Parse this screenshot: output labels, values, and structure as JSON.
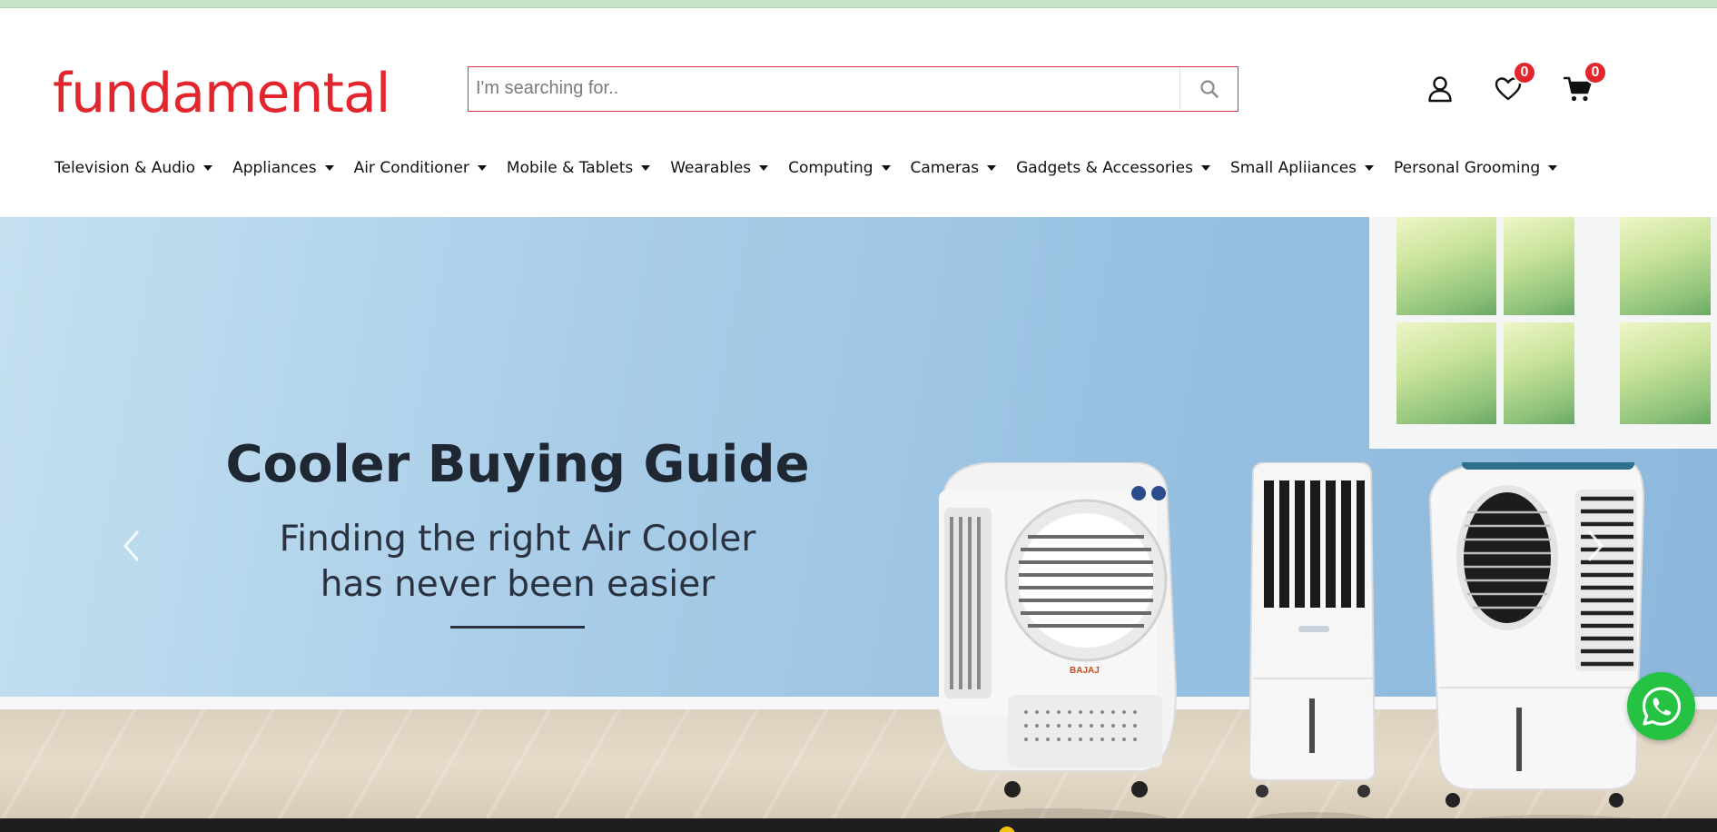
{
  "brand": {
    "logo_text": "fundamental",
    "accent_color": "#e3262d"
  },
  "search": {
    "placeholder": "I'm searching for..",
    "icon": "search-icon"
  },
  "header_actions": {
    "account_icon": "user-icon",
    "wishlist": {
      "icon": "heart-icon",
      "count": "0"
    },
    "cart": {
      "icon": "cart-icon",
      "count": "0"
    }
  },
  "nav": {
    "items": [
      {
        "label": "Television & Audio"
      },
      {
        "label": "Appliances"
      },
      {
        "label": "Air Conditioner"
      },
      {
        "label": "Mobile & Tablets"
      },
      {
        "label": "Wearables"
      },
      {
        "label": "Computing"
      },
      {
        "label": "Cameras"
      },
      {
        "label": "Gadgets & Accessories"
      },
      {
        "label": "Small Apliiances"
      },
      {
        "label": "Personal Grooming"
      }
    ]
  },
  "banner": {
    "title": "Cooler Buying Guide",
    "subtitle_line1": "Finding the right Air Cooler",
    "subtitle_line2": "has never been easier",
    "product_brand": "BAJAJ",
    "prev_icon": "chevron-left-icon",
    "next_icon": "chevron-right-icon"
  },
  "whatsapp": {
    "icon": "whatsapp-icon",
    "color": "#25c244"
  }
}
